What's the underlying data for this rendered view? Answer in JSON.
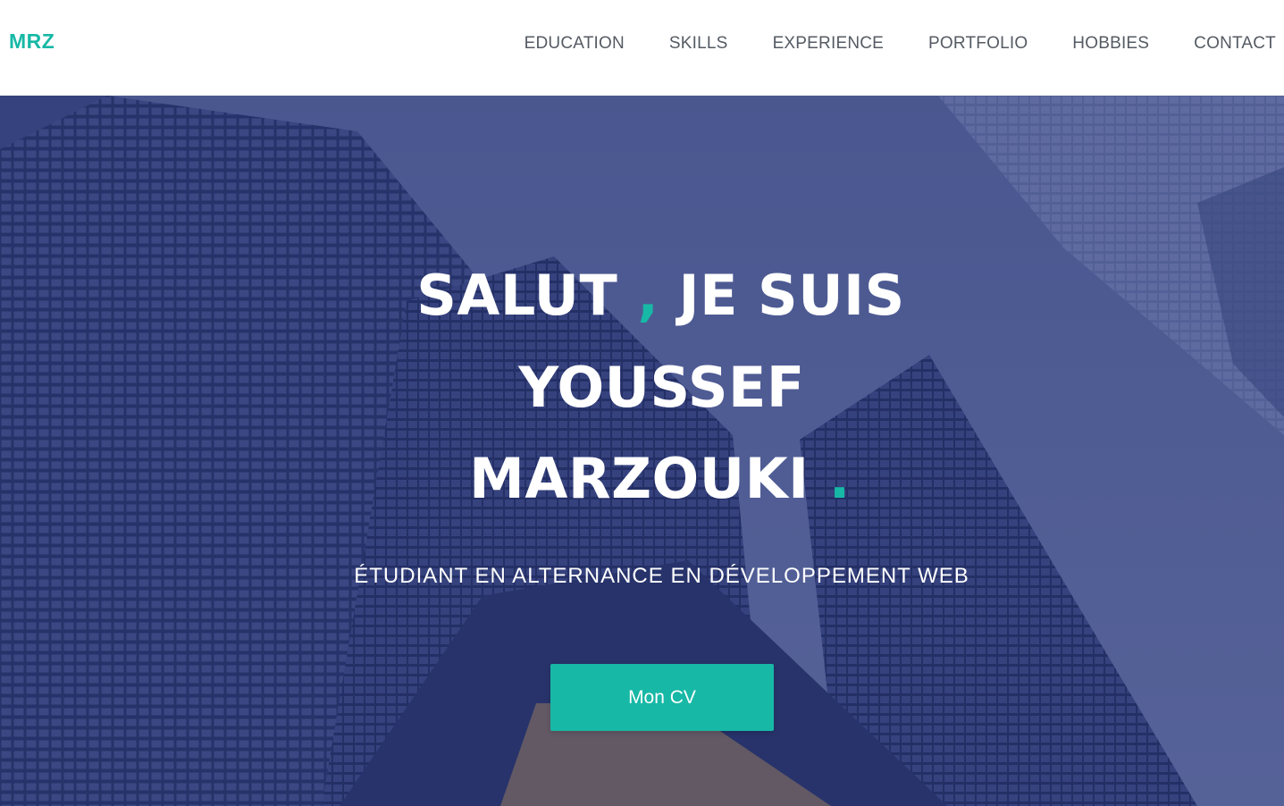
{
  "header": {
    "logo": "MRZ",
    "nav": [
      {
        "label": "EDUCATION"
      },
      {
        "label": "SKILLS"
      },
      {
        "label": "EXPERIENCE"
      },
      {
        "label": "PORTFOLIO"
      },
      {
        "label": "HOBBIES"
      },
      {
        "label": "CONTACT"
      }
    ]
  },
  "hero": {
    "line1_a": "SALUT",
    "line1_comma": ",",
    "line1_b": "JE SUIS",
    "line2": "YOUSSEF",
    "line3": "MARZOUKI",
    "line3_dot": ".",
    "subtitle": "ÉTUDIANT EN ALTERNANCE EN DÉVELOPPEMENT WEB",
    "cta_label": "Mon CV",
    "background_icon": "skyscrapers-photo"
  },
  "colors": {
    "accent": "#17b8a6",
    "overlay": "#2d3a78",
    "nav_text": "#555b63",
    "hero_text": "#ffffff"
  }
}
